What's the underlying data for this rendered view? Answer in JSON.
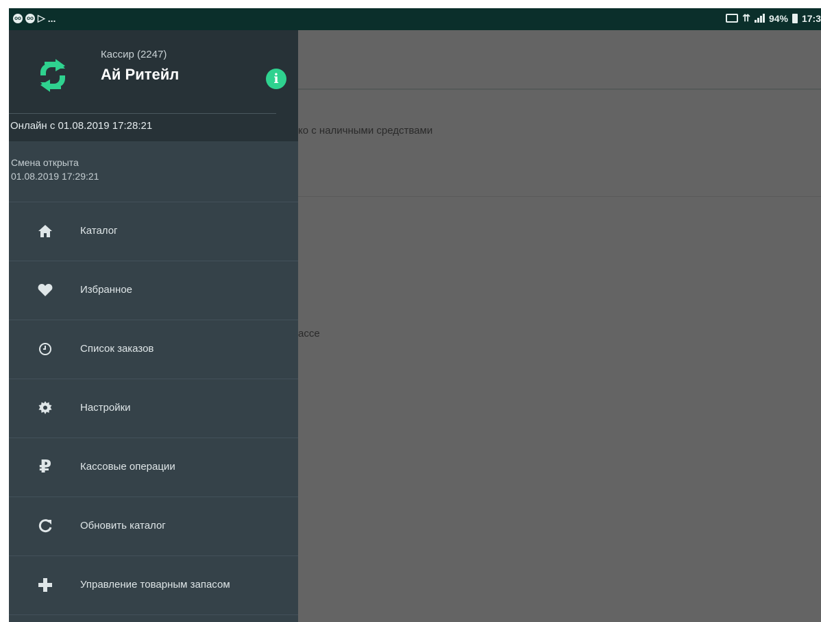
{
  "statusbar": {
    "battery": "94%",
    "time": "17:3",
    "overflow": "..."
  },
  "drawer": {
    "cashier": "Кассир (2247)",
    "shop_name": "Ай Ритейл",
    "info_glyph": "i",
    "online": "Онлайн с 01.08.2019 17:28:21",
    "shift_label": "Смена открыта",
    "shift_time": "01.08.2019 17:29:21",
    "menu": [
      {
        "label": "Каталог",
        "icon": "home-icon"
      },
      {
        "label": "Избранное",
        "icon": "heart-icon"
      },
      {
        "label": "Список заказов",
        "icon": "clock-icon"
      },
      {
        "label": "Настройки",
        "icon": "gear-icon"
      },
      {
        "label": "Кассовые операции",
        "icon": "ruble-icon"
      },
      {
        "label": "Обновить каталог",
        "icon": "refresh-icon"
      },
      {
        "label": "Управление товарным запасом",
        "icon": "plus-icon"
      }
    ]
  },
  "background": {
    "text1": "ко с наличными средствами",
    "text2": "ассе"
  },
  "colors": {
    "accent": "#2fd28f",
    "drawer": "#354249",
    "drawer_header": "#273237",
    "statusbar": "#0b2f2b"
  }
}
